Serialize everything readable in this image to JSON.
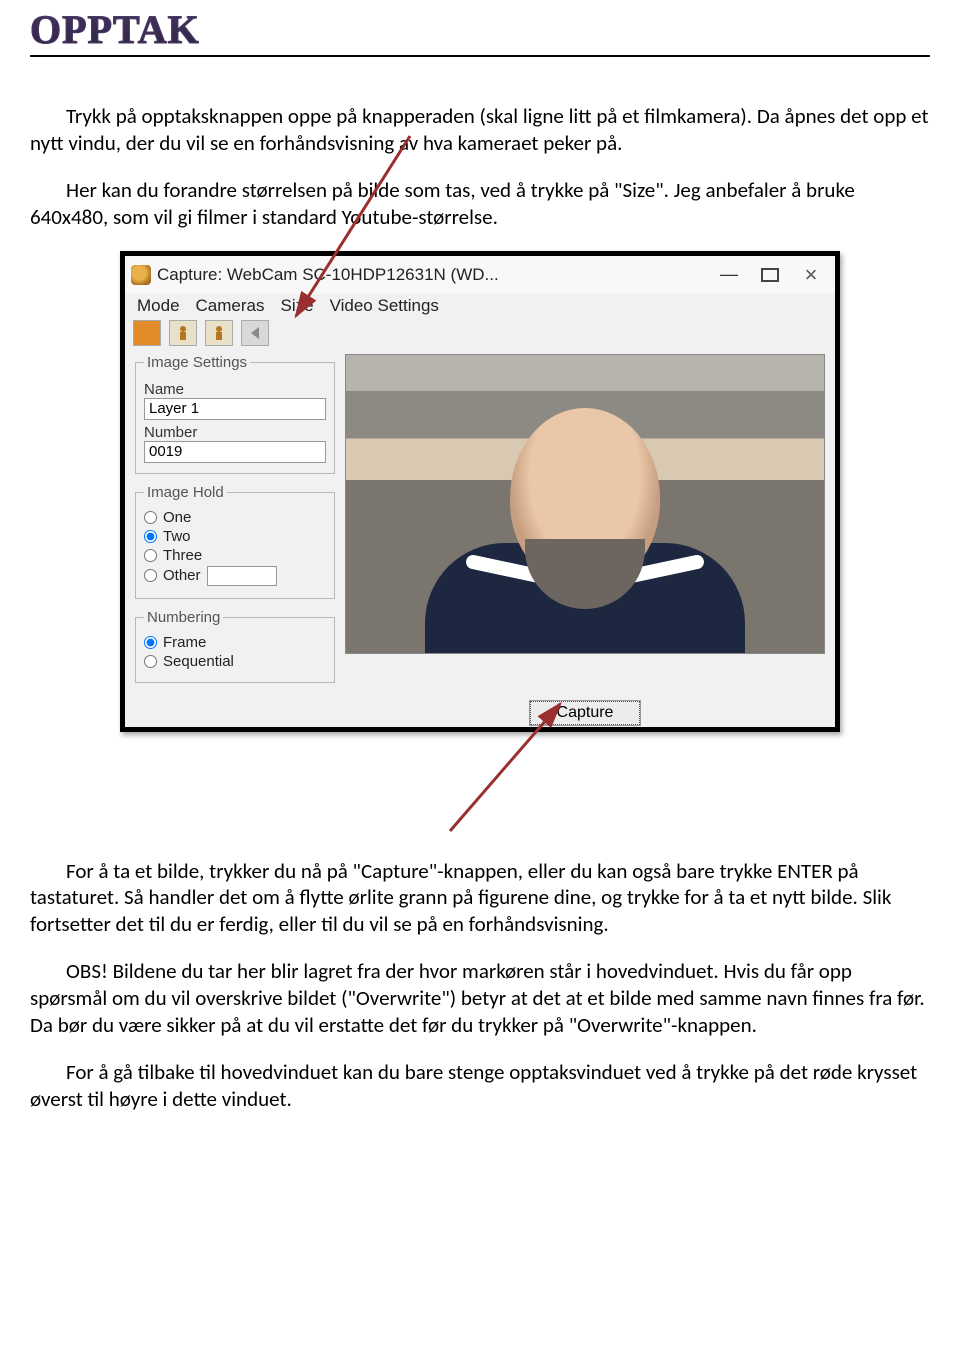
{
  "page": {
    "title": "OPPTAK",
    "para1": "Trykk på opptaksknappen oppe på knapperaden (skal ligne litt på et filmkamera). Da åpnes det opp et nytt vindu, der du vil se en forhåndsvisning av hva kameraet peker på.",
    "para2": "Her kan du forandre størrelsen på bilde som tas, ved å trykke på \"Size\". Jeg anbefaler å bruke 640x480, som vil gi filmer i standard Youtube-størrelse.",
    "para3": "For å ta et bilde, trykker du nå på \"Capture\"-knappen, eller du kan også bare trykke ENTER på tastaturet. Så handler det om å flytte ørlite grann på figurene dine, og trykke for å ta et nytt bilde. Slik fortsetter det til du er ferdig, eller til du vil se på en forhåndsvisning.",
    "para4": "OBS! Bildene du tar her blir lagret fra der hvor markøren står i hovedvinduet. Hvis du får opp spørsmål om du vil overskrive bildet (\"Overwrite\") betyr at det at et bilde med samme navn finnes fra før. Da bør du være sikker på at du vil erstatte det før du trykker på \"Overwrite\"-knappen.",
    "para5": "For å gå tilbake til hovedvinduet kan du bare stenge opptaksvinduet ved å trykke på det røde krysset øverst til høyre i dette vinduet."
  },
  "window": {
    "title": "Capture: WebCam SC-10HDP12631N (WD...",
    "menu": {
      "mode": "Mode",
      "cameras": "Cameras",
      "size": "Size",
      "video_settings": "Video Settings"
    },
    "image_settings_legend": "Image Settings",
    "name_label": "Name",
    "name_value": "Layer 1",
    "number_label": "Number",
    "number_value": "0019",
    "image_hold_legend": "Image Hold",
    "hold_options": {
      "one": "One",
      "two": "Two",
      "three": "Three",
      "other": "Other"
    },
    "hold_selected": "two",
    "numbering_legend": "Numbering",
    "numbering_options": {
      "frame": "Frame",
      "sequential": "Sequential"
    },
    "numbering_selected": "frame",
    "capture_label": "Capture"
  }
}
